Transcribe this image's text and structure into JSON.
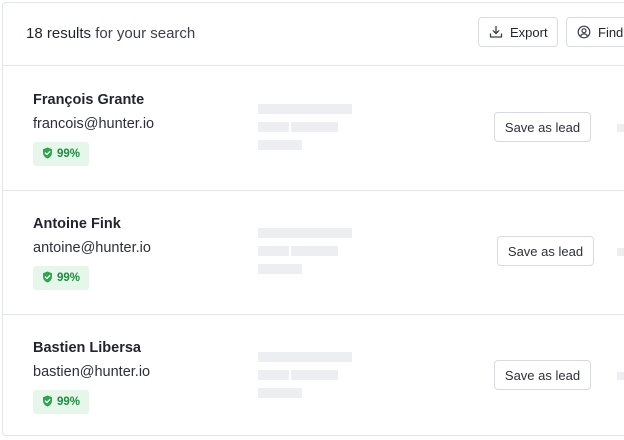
{
  "header": {
    "results_count": "18 results",
    "results_suffix": " for your search",
    "export_label": "Export",
    "find_label": "Find"
  },
  "results": [
    {
      "name": "François Grante",
      "email": "francois@hunter.io",
      "score": "99%",
      "action": "Save as lead"
    },
    {
      "name": "Antoine Fink",
      "email": "antoine@hunter.io",
      "score": "99%",
      "action": "Save as lead"
    },
    {
      "name": "Bastien Libersa",
      "email": "bastien@hunter.io",
      "score": "99%",
      "action": "Save as lead"
    }
  ],
  "colors": {
    "badge_bg": "#e6f6ea",
    "badge_text": "#1e8b3e",
    "skeleton": "#eceef1",
    "border": "#e3e5ea"
  },
  "icons": {
    "export": "download-tray-icon",
    "find": "user-circle-icon",
    "badge": "shield-check-icon"
  }
}
